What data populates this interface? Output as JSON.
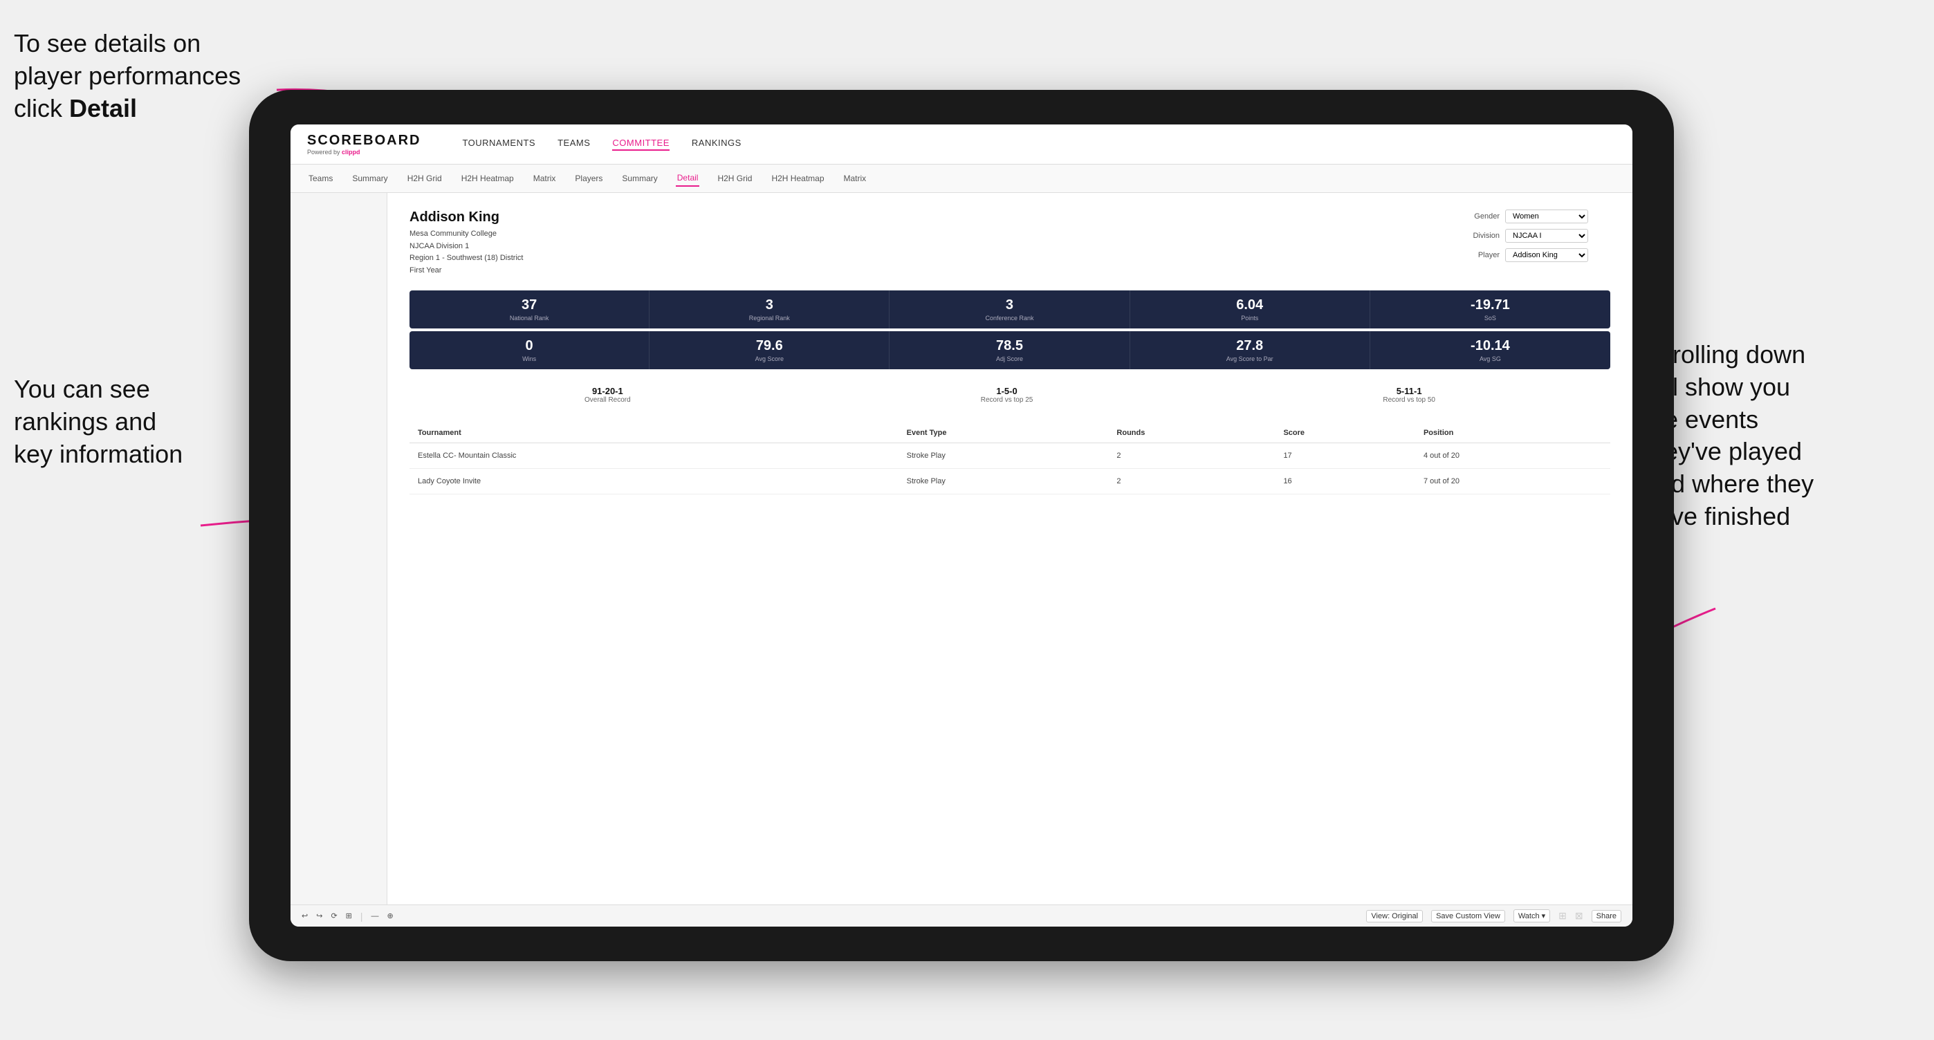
{
  "annotations": {
    "topleft": "To see details on player performances click ",
    "topleft_bold": "Detail",
    "bottomleft_line1": "You can see",
    "bottomleft_line2": "rankings and",
    "bottomleft_line3": "key information",
    "right_line1": "Scrolling down",
    "right_line2": "will show you",
    "right_line3": "the events",
    "right_line4": "they've played",
    "right_line5": "and where they",
    "right_line6": "have finished"
  },
  "nav": {
    "logo": "SCOREBOARD",
    "powered_by": "Powered by ",
    "clippd": "clippd",
    "links": [
      "TOURNAMENTS",
      "TEAMS",
      "COMMITTEE",
      "RANKINGS"
    ],
    "active_link": "COMMITTEE"
  },
  "sub_nav": {
    "links": [
      "Teams",
      "Summary",
      "H2H Grid",
      "H2H Heatmap",
      "Matrix",
      "Players",
      "Summary",
      "Detail",
      "H2H Grid",
      "H2H Heatmap",
      "Matrix"
    ],
    "active": "Detail"
  },
  "player": {
    "name": "Addison King",
    "college": "Mesa Community College",
    "division": "NJCAA Division 1",
    "region": "Region 1 - Southwest (18) District",
    "year": "First Year"
  },
  "controls": {
    "gender_label": "Gender",
    "gender_value": "Women",
    "division_label": "Division",
    "division_value": "NJCAA I",
    "player_label": "Player",
    "player_value": "Addison King"
  },
  "stats_row1": [
    {
      "value": "37",
      "label": "National Rank"
    },
    {
      "value": "3",
      "label": "Regional Rank"
    },
    {
      "value": "3",
      "label": "Conference Rank"
    },
    {
      "value": "6.04",
      "label": "Points"
    },
    {
      "value": "-19.71",
      "label": "SoS"
    }
  ],
  "stats_row2": [
    {
      "value": "0",
      "label": "Wins"
    },
    {
      "value": "79.6",
      "label": "Avg Score"
    },
    {
      "value": "78.5",
      "label": "Adj Score"
    },
    {
      "value": "27.8",
      "label": "Avg Score to Par"
    },
    {
      "value": "-10.14",
      "label": "Avg SG"
    }
  ],
  "records": [
    {
      "value": "91-20-1",
      "label": "Overall Record"
    },
    {
      "value": "1-5-0",
      "label": "Record vs top 25"
    },
    {
      "value": "5-11-1",
      "label": "Record vs top 50"
    }
  ],
  "table": {
    "headers": [
      "Tournament",
      "",
      "Event Type",
      "Rounds",
      "Score",
      "Position"
    ],
    "rows": [
      {
        "tournament": "Estella CC- Mountain Classic",
        "event_type": "Stroke Play",
        "rounds": "2",
        "score": "17",
        "position": "4 out of 20"
      },
      {
        "tournament": "Lady Coyote Invite",
        "event_type": "Stroke Play",
        "rounds": "2",
        "score": "16",
        "position": "7 out of 20"
      }
    ]
  },
  "toolbar": {
    "buttons": [
      "View: Original",
      "Save Custom View",
      "Watch ▾",
      "Share"
    ],
    "icons": [
      "↩",
      "↪",
      "🔄",
      "📋",
      "—",
      "⊕",
      "🕐"
    ]
  }
}
